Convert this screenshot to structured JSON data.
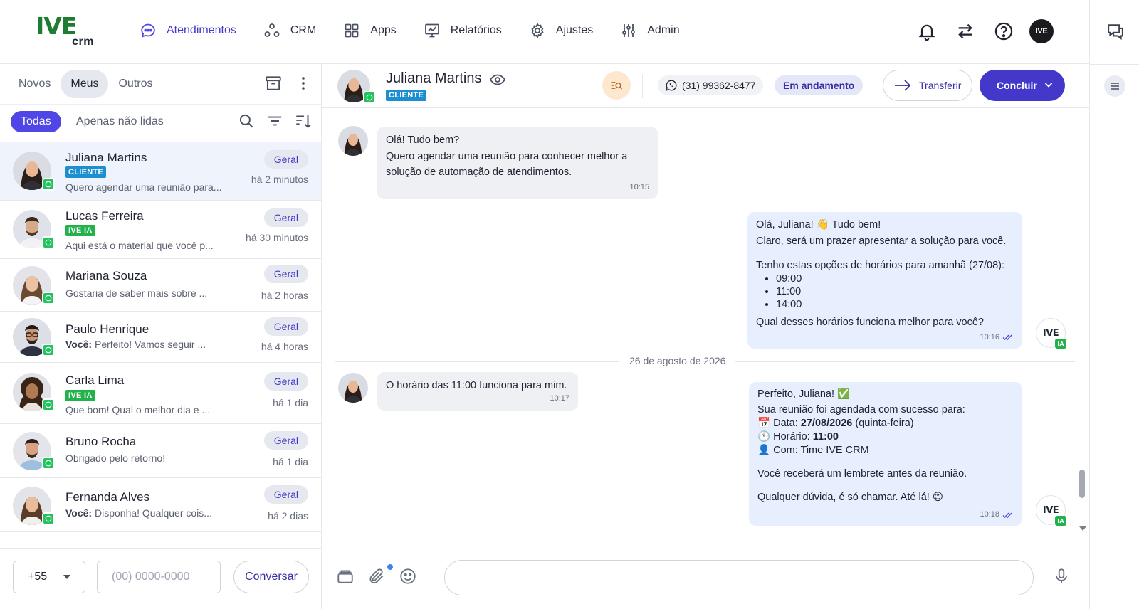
{
  "app": {
    "logo_text": "IVE",
    "logo_sub": "crm"
  },
  "nav": {
    "items": [
      {
        "label": "Atendimentos",
        "icon": "chat-bubble-icon",
        "active": true
      },
      {
        "label": "CRM",
        "icon": "nodes-icon"
      },
      {
        "label": "Apps",
        "icon": "grid-icon"
      },
      {
        "label": "Relatórios",
        "icon": "chart-board-icon"
      },
      {
        "label": "Ajustes",
        "icon": "gear-icon"
      },
      {
        "label": "Admin",
        "icon": "sliders-icon"
      }
    ],
    "avatar_initials": "IVE"
  },
  "left": {
    "tabs": [
      "Novos",
      "Meus",
      "Outros"
    ],
    "active_tab": "Meus",
    "filter_all": "Todas",
    "filter_unread": "Apenas não lidas",
    "conversations": [
      {
        "name": "Juliana Martins",
        "tag": "CLIENTE",
        "preview": "Quero agendar uma reunião para...",
        "queue": "Geral",
        "time": "há 2 minutos",
        "selected": true
      },
      {
        "name": "Lucas Ferreira",
        "tag": "IVE IA",
        "preview": "Aqui está o material que você p...",
        "queue": "Geral",
        "time": "há 30 minutos"
      },
      {
        "name": "Mariana Souza",
        "preview": "Gostaria de saber mais sobre ...",
        "queue": "Geral",
        "time": "há 2 horas"
      },
      {
        "name": "Paulo Henrique",
        "preview_prefix": "Você:",
        "preview": " Perfeito! Vamos seguir ...",
        "queue": "Geral",
        "time": "há 4 horas"
      },
      {
        "name": "Carla Lima",
        "tag": "IVE IA",
        "preview": "Que bom! Qual o melhor dia e ...",
        "queue": "Geral",
        "time": "há 1 dia"
      },
      {
        "name": "Bruno Rocha",
        "preview": "Obrigado pelo retorno!",
        "queue": "Geral",
        "time": "há 1 dia"
      },
      {
        "name": "Fernanda Alves",
        "preview_prefix": "Você:",
        "preview": " Disponha! Qualquer cois...",
        "queue": "Geral",
        "time": "há 2 dias"
      }
    ],
    "country_code": "+55",
    "phone_placeholder": "(00) 0000-0000",
    "start_button": "Conversar"
  },
  "chat": {
    "contact_name": "Juliana Martins",
    "contact_tag": "CLIENTE",
    "phone": "(31) 99362-8477",
    "status": "Em andamento",
    "transfer_label": "Transferir",
    "conclude_label": "Concluir",
    "date_divider": "26 de agosto de 2026",
    "messages": {
      "m1": {
        "lines": [
          "Olá! Tudo bem?",
          "Quero agendar uma reunião para conhecer melhor a",
          "solução de automação de atendimentos."
        ],
        "time": "10:15"
      },
      "m2": {
        "line1": "Olá, Juliana! 👋 Tudo bem!",
        "line2": "Claro, será um prazer apresentar a solução para você.",
        "line3": "Tenho estas opções de horários para amanhã (27/08):",
        "options": [
          "09:00",
          "11:00",
          "14:00"
        ],
        "line4": "Qual desses horários funciona melhor para você?",
        "time": "10:16"
      },
      "m3": {
        "text": "O horário das 11:00 funciona para mim.",
        "time": "10:17"
      },
      "m4": {
        "line1": "Perfeito, Juliana! ✅",
        "line2": "Sua reunião foi agendada com sucesso para:",
        "date_label": "Data:",
        "date_value": "27/08/2026",
        "date_suffix": "(quinta-feira)",
        "hour_label": "Horário:",
        "hour_value": "11:00",
        "with_label": "Com: Time IVE CRM",
        "line3": "Você receberá um lembrete antes da reunião.",
        "line4": "Qualquer dúvida, é só chamar. Até lá! 😊",
        "time": "10:18"
      }
    },
    "bot_avatar": "IVE",
    "bot_badge": "IA"
  },
  "colors": {
    "accent": "#4338ca",
    "whatsapp": "#22c35e",
    "brand_green": "#1e7d32",
    "tag_cliente": "#1d8fd1",
    "tag_iveia": "#22b24c"
  }
}
